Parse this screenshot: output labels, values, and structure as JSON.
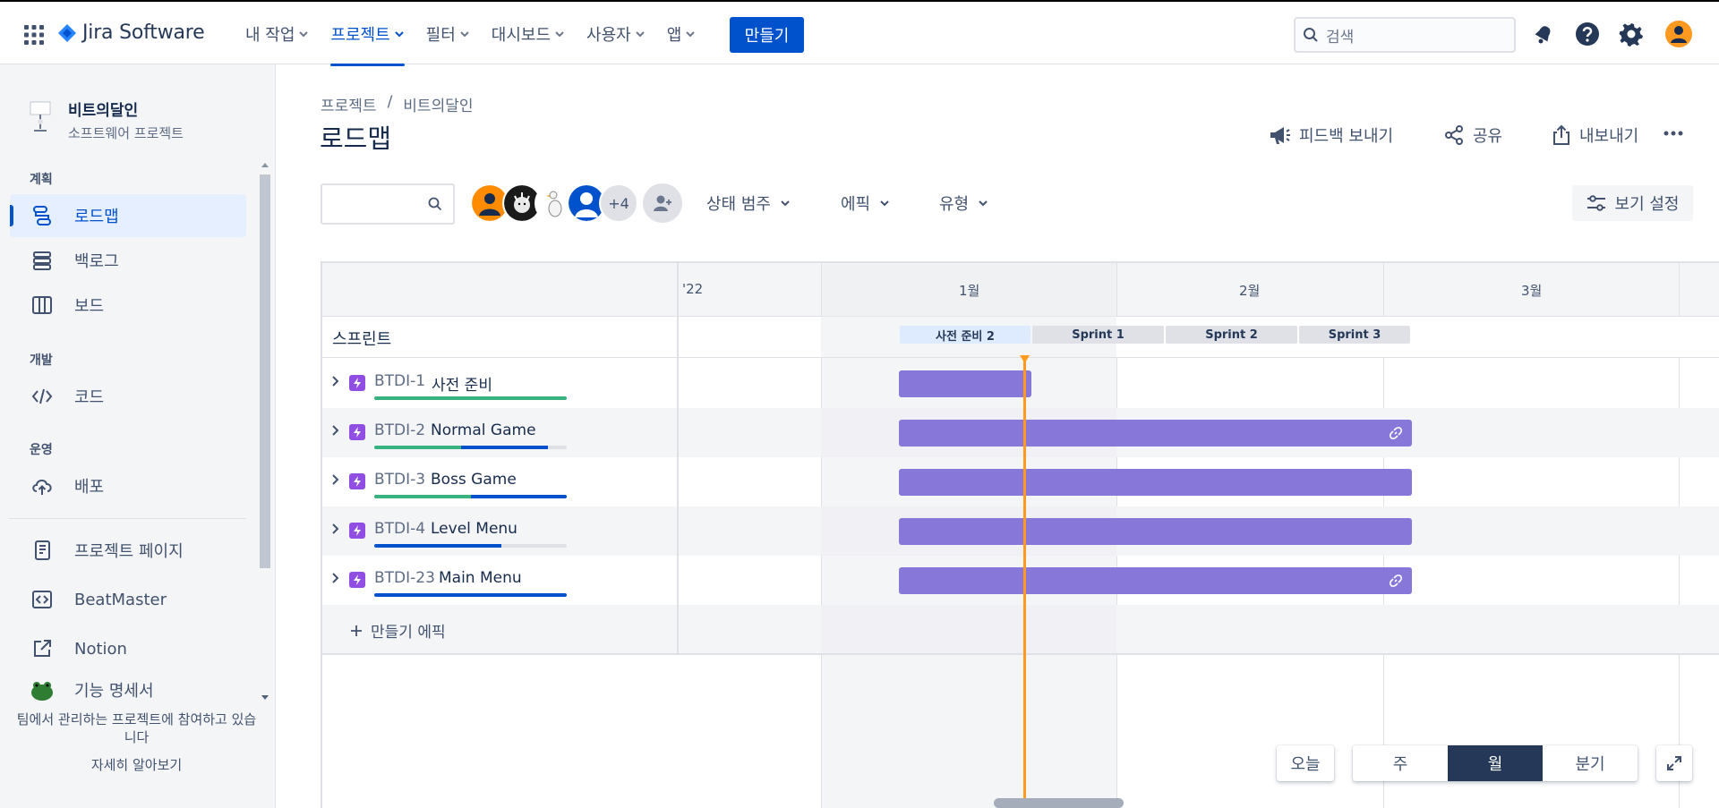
{
  "app": {
    "name": "Jira Software"
  },
  "nav": {
    "items": [
      {
        "label": "내 작업"
      },
      {
        "label": "프로젝트"
      },
      {
        "label": "필터"
      },
      {
        "label": "대시보드"
      },
      {
        "label": "사용자"
      },
      {
        "label": "앱"
      }
    ],
    "create": "만들기",
    "search_placeholder": "검색"
  },
  "sidebar": {
    "project_name": "비트의달인",
    "project_type": "소프트웨어 프로젝트",
    "sections": {
      "plan": "계획",
      "dev": "개발",
      "ops": "운영"
    },
    "items": {
      "roadmap": "로드맵",
      "backlog": "백로그",
      "board": "보드",
      "code": "코드",
      "deploy": "배포",
      "project_page": "프로젝트 페이지",
      "beatmaster": "BeatMaster",
      "notion": "Notion",
      "spec": "기능 명세서"
    },
    "footer_msg": "팀에서 관리하는 프로젝트에 참여하고 있습니다",
    "footer_more": "자세히 알아보기"
  },
  "page": {
    "breadcrumb": [
      "프로젝트",
      "/",
      "비트의달인"
    ],
    "title": "로드맵",
    "actions": {
      "feedback": "피드백 보내기",
      "share": "공유",
      "export": "내보내기"
    }
  },
  "filters": {
    "more_avatars": "+4",
    "status": "상태 범주",
    "epic": "에픽",
    "type": "유형",
    "view_settings": "보기 설정"
  },
  "timeline": {
    "months": [
      "'22",
      "1월",
      "2월",
      "3월"
    ],
    "sprint_label": "스프린트",
    "sprints": [
      "사전 준비 2",
      "Sprint 1",
      "Sprint 2",
      "Sprint 3"
    ],
    "epics": [
      {
        "key": "BTDI-1",
        "name": "사전 준비",
        "progress_done": 1.0,
        "progress_inprogress": 0.0
      },
      {
        "key": "BTDI-2",
        "name": "Normal Game",
        "progress_done": 0.45,
        "progress_inprogress": 0.45
      },
      {
        "key": "BTDI-3",
        "name": "Boss Game",
        "progress_done": 0.5,
        "progress_inprogress": 0.5
      },
      {
        "key": "BTDI-4",
        "name": "Level Menu",
        "progress_done": 0.0,
        "progress_inprogress": 0.66
      },
      {
        "key": "BTDI-23",
        "name": "Main Menu",
        "progress_done": 0.0,
        "progress_inprogress": 1.0
      }
    ],
    "create_epic": "만들기 에픽"
  },
  "controls": {
    "today": "오늘",
    "week": "주",
    "month": "월",
    "quarter": "분기",
    "selected": "월"
  }
}
